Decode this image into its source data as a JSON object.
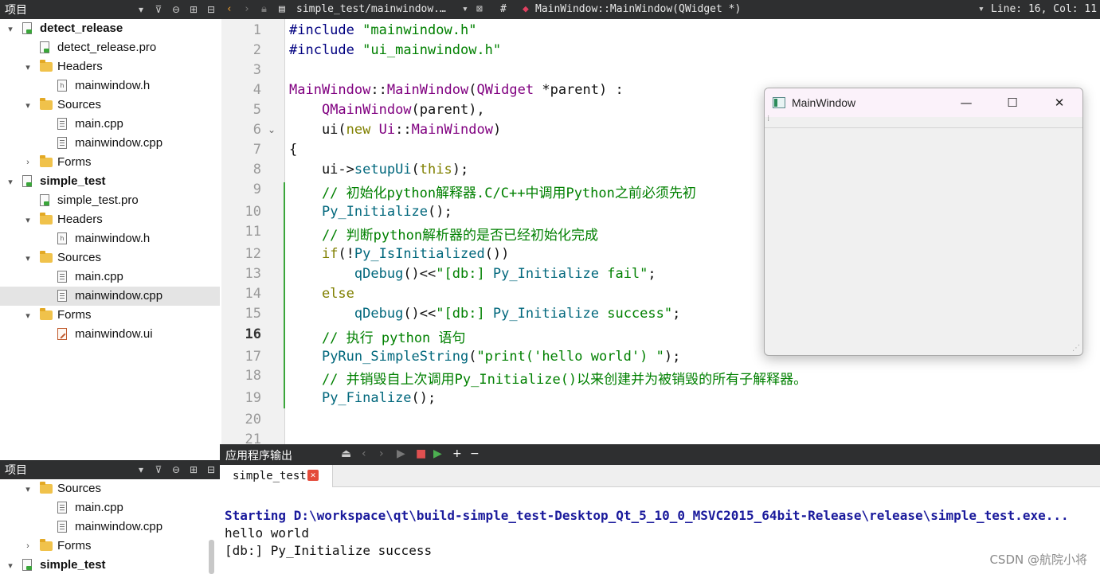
{
  "project_panel_top": {
    "title": "项目",
    "items": [
      {
        "label": "detect_release",
        "icon": "project-icon",
        "arrow": "▾"
      },
      {
        "label": "detect_release.pro",
        "icon": "pro-file-icon",
        "arrow": ""
      },
      {
        "label": "Headers",
        "icon": "folder-icon",
        "arrow": "▾"
      },
      {
        "label": "mainwindow.h",
        "icon": "header-file-icon",
        "arrow": ""
      },
      {
        "label": "Sources",
        "icon": "folder-icon",
        "arrow": "▾"
      },
      {
        "label": "main.cpp",
        "icon": "file-icon",
        "arrow": ""
      },
      {
        "label": "mainwindow.cpp",
        "icon": "file-icon",
        "arrow": ""
      },
      {
        "label": "Forms",
        "icon": "folder-icon",
        "arrow": "›"
      },
      {
        "label": "simple_test",
        "icon": "project-icon",
        "arrow": "▾"
      },
      {
        "label": "simple_test.pro",
        "icon": "pro-file-icon",
        "arrow": ""
      },
      {
        "label": "Headers",
        "icon": "folder-icon",
        "arrow": "▾"
      },
      {
        "label": "mainwindow.h",
        "icon": "header-file-icon",
        "arrow": ""
      },
      {
        "label": "Sources",
        "icon": "folder-icon",
        "arrow": "▾"
      },
      {
        "label": "main.cpp",
        "icon": "file-icon",
        "arrow": ""
      },
      {
        "label": "mainwindow.cpp",
        "icon": "file-icon",
        "arrow": ""
      },
      {
        "label": "Forms",
        "icon": "folder-icon",
        "arrow": "▾"
      },
      {
        "label": "mainwindow.ui",
        "icon": "ui-file-icon",
        "arrow": ""
      }
    ]
  },
  "project_panel_bottom": {
    "title": "项目",
    "items": [
      {
        "label": "Sources",
        "icon": "folder-icon",
        "arrow": "▾"
      },
      {
        "label": "main.cpp",
        "icon": "file-icon",
        "arrow": ""
      },
      {
        "label": "mainwindow.cpp",
        "icon": "file-icon",
        "arrow": ""
      },
      {
        "label": "Forms",
        "icon": "folder-icon",
        "arrow": "›"
      },
      {
        "label": "simple_test",
        "icon": "project-icon",
        "arrow": "▾"
      }
    ]
  },
  "editor_toolbar": {
    "file_path": "simple_test/mainwindow.…",
    "symbol_hash": "#",
    "symbol": "MainWindow::MainWindow(QWidget *)",
    "cursor_pos": "Line: 16, Col: 11"
  },
  "editor": {
    "current_line": 16,
    "line_numbers": [
      "1",
      "2",
      "3",
      "4",
      "5",
      "6",
      "7",
      "8",
      "9",
      "10",
      "11",
      "12",
      "13",
      "14",
      "15",
      "16",
      "17",
      "18",
      "19",
      "20",
      "21"
    ],
    "lines": [
      "#include \"mainwindow.h\"",
      "#include \"ui_mainwindow.h\"",
      "",
      "MainWindow::MainWindow(QWidget *parent) :",
      "    QMainWindow(parent),",
      "    ui(new Ui::MainWindow)",
      "{",
      "    ui->setupUi(this);",
      "    // 初始化python解释器.C/C++中调用Python之前必须先初",
      "    Py_Initialize();",
      "    // 判断python解析器的是否已经初始化完成",
      "    if(!Py_IsInitialized())",
      "        qDebug()<<\"[db:] Py_Initialize fail\";",
      "    else",
      "        qDebug()<<\"[db:] Py_Initialize success\";",
      "    // 执行 python 语句",
      "    PyRun_SimpleString(\"print('hello world') \");",
      "    // 并销毁自上次调用Py_Initialize()以来创建并为被销毁的所有子解释器。",
      "    Py_Finalize();",
      "",
      ""
    ]
  },
  "mainwindow": {
    "title": "MainWindow",
    "minimize": "—",
    "maximize": "☐",
    "close": "✕"
  },
  "output": {
    "title": "应用程序输出",
    "tab_label": "simple_test",
    "lines": [
      "Starting D:\\workspace\\qt\\build-simple_test-Desktop_Qt_5_10_0_MSVC2015_64bit-Release\\release\\simple_test.exe...",
      "hello world",
      "[db:] Py_Initialize success"
    ],
    "watermark": "CSDN @航院小将"
  }
}
